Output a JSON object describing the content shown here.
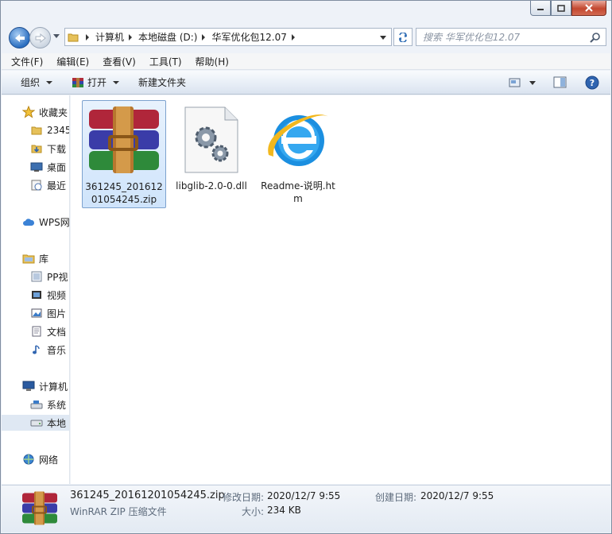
{
  "window": {
    "caption": {
      "minimize": "minimize",
      "maximize": "maximize",
      "close": "close"
    }
  },
  "address": {
    "crumbs": [
      "计算机",
      "本地磁盘 (D:)",
      "华军优化包12.07"
    ],
    "search_placeholder": "搜索 华军优化包12.07"
  },
  "menu": [
    "文件(F)",
    "编辑(E)",
    "查看(V)",
    "工具(T)",
    "帮助(H)"
  ],
  "toolbar": {
    "organize": "组织",
    "open": "打开",
    "new_folder": "新建文件夹"
  },
  "sidebar": {
    "items": [
      {
        "label": "收藏夹",
        "icon": "star-icon"
      },
      {
        "label": "2345",
        "icon": "folder-icon"
      },
      {
        "label": "下载",
        "icon": "download-folder-icon"
      },
      {
        "label": "桌面",
        "icon": "desktop-icon"
      },
      {
        "label": "最近",
        "icon": "recent-places-icon"
      },
      {
        "label": "WPS网",
        "icon": "cloud-icon"
      },
      {
        "label": "库",
        "icon": "library-icon"
      },
      {
        "label": "PP视",
        "icon": "video-library-icon"
      },
      {
        "label": "视频",
        "icon": "video-library-icon"
      },
      {
        "label": "图片",
        "icon": "pictures-icon"
      },
      {
        "label": "文档",
        "icon": "documents-icon"
      },
      {
        "label": "音乐",
        "icon": "music-icon"
      },
      {
        "label": "计算机",
        "icon": "computer-icon"
      },
      {
        "label": "系统",
        "icon": "drive-icon"
      },
      {
        "label": "本地",
        "icon": "drive-icon"
      },
      {
        "label": "网络",
        "icon": "network-icon"
      }
    ]
  },
  "files": [
    {
      "name": "361245_20161201054245.zip",
      "icon": "winrar-archive-icon",
      "selected": true
    },
    {
      "name": "libglib-2.0-0.dll",
      "icon": "dll-gear-icon",
      "selected": false
    },
    {
      "name": "Readme-说明.htm",
      "icon": "internet-explorer-icon",
      "selected": false
    }
  ],
  "details": {
    "filename": "361245_20161201054245.zip",
    "type": "WinRAR ZIP 压缩文件",
    "modified_label": "修改日期:",
    "modified_value": "2020/12/7 9:55",
    "size_label": "大小:",
    "size_value": "234 KB",
    "created_label": "创建日期:",
    "created_value": "2020/12/7 9:55"
  }
}
